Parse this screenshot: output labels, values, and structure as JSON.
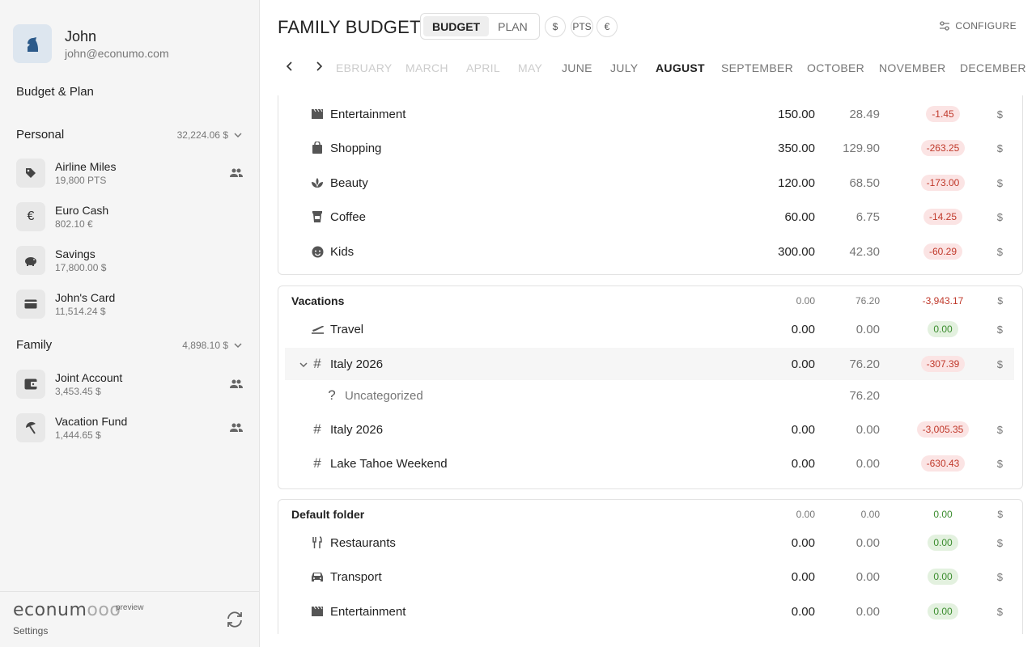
{
  "profile": {
    "name": "John",
    "email": "john@econumo.com"
  },
  "nav": {
    "budget_plan": "Budget & Plan"
  },
  "groups": [
    {
      "name": "Personal",
      "total": "32,224.06 $"
    },
    {
      "name": "Family",
      "total": "4,898.10 $"
    }
  ],
  "accounts": [
    {
      "name": "Airline Miles",
      "balance": "19,800 PTS",
      "icon": "tag-icon",
      "shared": true
    },
    {
      "name": "Euro Cash",
      "balance": "802.10 €",
      "icon": "euro-icon",
      "shared": false
    },
    {
      "name": "Savings",
      "balance": "17,800.00 $",
      "icon": "piggy-bank-icon",
      "shared": false
    },
    {
      "name": "John's Card",
      "balance": "11,514.24 $",
      "icon": "credit-card-icon",
      "shared": false
    },
    {
      "name": "Joint Account",
      "balance": "3,453.45 $",
      "icon": "wallet-icon",
      "shared": true
    },
    {
      "name": "Vacation Fund",
      "balance": "1,444.65 $",
      "icon": "beach-umbrella-icon",
      "shared": true
    }
  ],
  "footer": {
    "logo": "econum",
    "logo_tail": "ooo",
    "preview": "preview",
    "settings": "Settings"
  },
  "header": {
    "title": "FAMILY BUDGET",
    "tab_budget": "BUDGET",
    "tab_plan": "PLAN",
    "currencies": [
      "$",
      "PTS",
      "€"
    ],
    "configure": "CONFIGURE"
  },
  "months": [
    "EBRUARY",
    "MARCH",
    "APRIL",
    "MAY",
    "JUNE",
    "JULY",
    "AUGUST",
    "SEPTEMBER",
    "OCTOBER",
    "NOVEMBER",
    "DECEMBER"
  ],
  "card1": [
    {
      "name": "Entertainment",
      "budget": "150.00",
      "spent": "28.49",
      "available": "-1.45",
      "cur": "$",
      "icon": "clapperboard-icon"
    },
    {
      "name": "Shopping",
      "budget": "350.00",
      "spent": "129.90",
      "available": "-263.25",
      "cur": "$",
      "icon": "shopping-bag-icon"
    },
    {
      "name": "Beauty",
      "budget": "120.00",
      "spent": "68.50",
      "available": "-173.00",
      "cur": "$",
      "icon": "spa-icon"
    },
    {
      "name": "Coffee",
      "budget": "60.00",
      "spent": "6.75",
      "available": "-14.25",
      "cur": "$",
      "icon": "coffee-cup-icon"
    },
    {
      "name": "Kids",
      "budget": "300.00",
      "spent": "42.30",
      "available": "-60.29",
      "cur": "$",
      "icon": "child-face-icon"
    }
  ],
  "vacations": {
    "folder": {
      "name": "Vacations",
      "budget": "0.00",
      "spent": "76.20",
      "available": "-3,943.17",
      "cur": "$"
    },
    "rows": [
      {
        "name": "Travel",
        "budget": "0.00",
        "spent": "0.00",
        "available": "0.00",
        "cur": "$"
      },
      {
        "name": "Italy 2026",
        "budget": "0.00",
        "spent": "76.20",
        "available": "-307.39",
        "cur": "$"
      },
      {
        "name": "Uncategorized",
        "spent": "76.20"
      },
      {
        "name": "Italy 2026",
        "budget": "0.00",
        "spent": "0.00",
        "available": "-3,005.35",
        "cur": "$"
      },
      {
        "name": "Lake Tahoe Weekend",
        "budget": "0.00",
        "spent": "0.00",
        "available": "-630.43",
        "cur": "$"
      }
    ]
  },
  "default_folder": {
    "folder": {
      "name": "Default folder",
      "budget": "0.00",
      "spent": "0.00",
      "available": "0.00",
      "cur": "$"
    },
    "rows": [
      {
        "name": "Restaurants",
        "budget": "0.00",
        "spent": "0.00",
        "available": "0.00",
        "cur": "$"
      },
      {
        "name": "Transport",
        "budget": "0.00",
        "spent": "0.00",
        "available": "0.00",
        "cur": "$"
      },
      {
        "name": "Entertainment",
        "budget": "0.00",
        "spent": "0.00",
        "available": "0.00",
        "cur": "$"
      }
    ]
  }
}
